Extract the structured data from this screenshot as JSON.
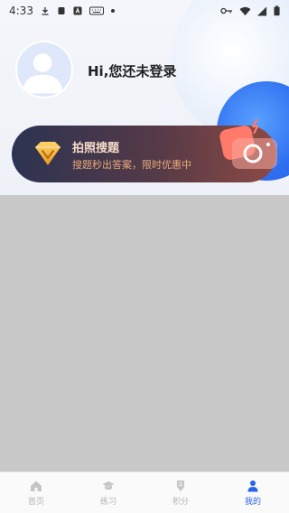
{
  "status_bar": {
    "time": "4:33"
  },
  "profile": {
    "greeting": "Hi,您还未登录"
  },
  "banner": {
    "title": "拍照搜题",
    "subtitle": "搜题秒出答案，限时优惠中"
  },
  "tabs": [
    {
      "label": "首页",
      "icon": "home-icon",
      "active": false
    },
    {
      "label": "练习",
      "icon": "graduation-cap-icon",
      "active": false
    },
    {
      "label": "积分",
      "icon": "points-icon",
      "active": false
    },
    {
      "label": "我的",
      "icon": "user-icon",
      "active": true
    }
  ],
  "colors": {
    "accent": "#2a64e8",
    "banner_title": "#f5dcc8",
    "banner_subtitle": "#e8a97a",
    "tab_inactive": "#b5b5b5"
  }
}
